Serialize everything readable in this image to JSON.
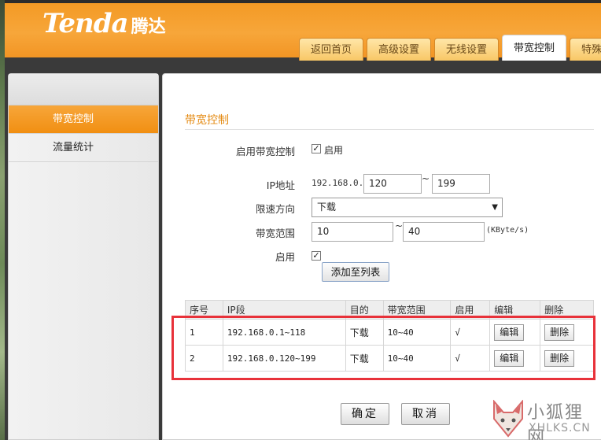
{
  "header": {
    "logo_en": "Tenda",
    "logo_cn": "腾达",
    "tabs": [
      {
        "label": "返回首页"
      },
      {
        "label": "高级设置"
      },
      {
        "label": "无线设置"
      },
      {
        "label": "带宽控制",
        "active": true
      },
      {
        "label": "特殊"
      }
    ]
  },
  "sidebar": {
    "items": [
      {
        "label": "带宽控制",
        "active": true
      },
      {
        "label": "流量统计"
      }
    ]
  },
  "main": {
    "section_title": "带宽控制",
    "enable_label": "启用带宽控制",
    "enable_checked": true,
    "enable_text": "启用",
    "ip_label": "IP地址",
    "ip_prefix": "192.168.0.",
    "ip_from": "120",
    "ip_sep": "~",
    "ip_to": "199",
    "direction_label": "限速方向",
    "direction_value": "下载",
    "range_label": "带宽范围",
    "range_from": "10",
    "range_sep": "~",
    "range_to": "40",
    "range_unit": "(KByte/s)",
    "rule_enable_label": "启用",
    "rule_enable_checked": true,
    "add_button": "添加至列表"
  },
  "table": {
    "headers": [
      "序号",
      "IP段",
      "目的",
      "带宽范围",
      "启用",
      "编辑",
      "删除"
    ],
    "rows": [
      {
        "no": "1",
        "ip": "192.168.0.1~118",
        "dir": "下载",
        "range": "10~40",
        "enabled": "√",
        "edit": "编辑",
        "del": "删除"
      },
      {
        "no": "2",
        "ip": "192.168.0.120~199",
        "dir": "下载",
        "range": "10~40",
        "enabled": "√",
        "edit": "编辑",
        "del": "删除"
      }
    ]
  },
  "footer": {
    "ok": "确定",
    "cancel": "取消"
  },
  "watermark": {
    "line1": "小狐狸网",
    "line2": "XHLKS.CN"
  },
  "colors": {
    "brand_orange": "#f39a25",
    "highlight_red": "#e8323a"
  }
}
